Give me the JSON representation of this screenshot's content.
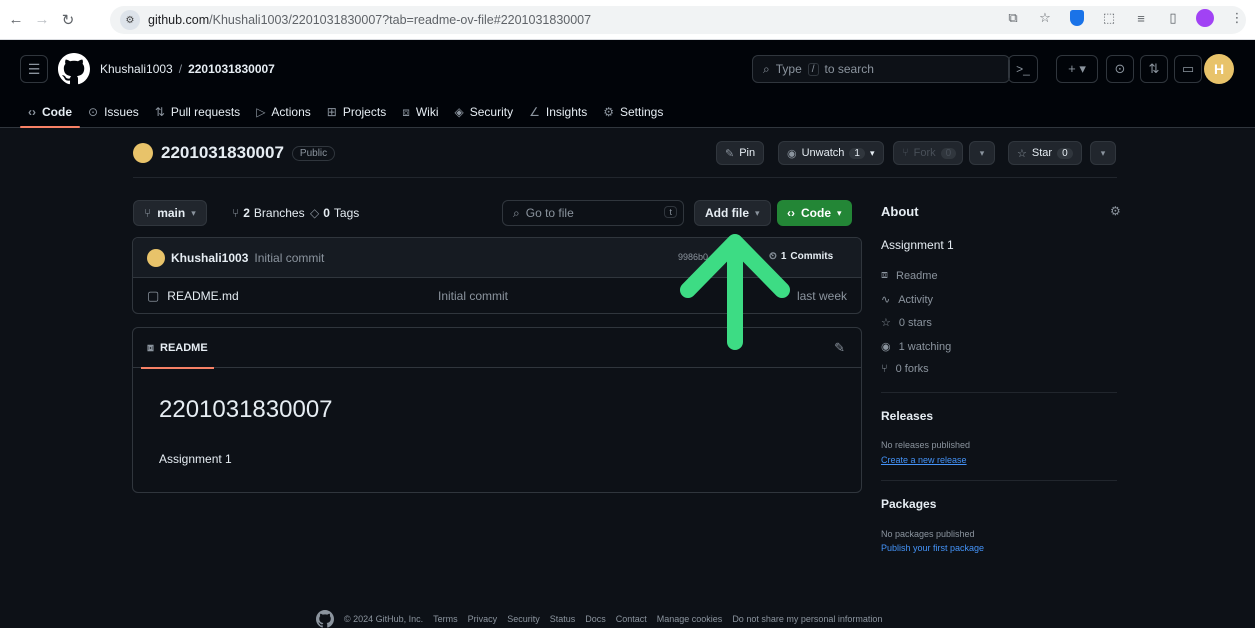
{
  "browser": {
    "url_host": "github.com",
    "url_path": "/Khushali1003/2201031830007?tab=readme-ov-file#2201031830007"
  },
  "header": {
    "owner": "Khushali1003",
    "separator": "/",
    "repo": "2201031830007",
    "search_placeholder": "Type",
    "search_key": "/",
    "search_suffix": "to search",
    "cmd": ">_",
    "avatar_letter": "H"
  },
  "tabs": [
    {
      "label": "Code",
      "icon": "code-icon"
    },
    {
      "label": "Issues",
      "icon": "issue-icon"
    },
    {
      "label": "Pull requests",
      "icon": "pull-request-icon"
    },
    {
      "label": "Actions",
      "icon": "play-icon"
    },
    {
      "label": "Projects",
      "icon": "table-icon"
    },
    {
      "label": "Wiki",
      "icon": "book-icon"
    },
    {
      "label": "Security",
      "icon": "shield-icon"
    },
    {
      "label": "Insights",
      "icon": "graph-icon"
    },
    {
      "label": "Settings",
      "icon": "gear-icon"
    }
  ],
  "repo_title": {
    "name": "2201031830007",
    "visibility": "Public"
  },
  "actions": {
    "pin": "Pin",
    "unwatch": "Unwatch",
    "unwatch_count": "1",
    "fork": "Fork",
    "fork_count": "0",
    "star": "Star",
    "star_count": "0"
  },
  "toolbar": {
    "branch": "main",
    "branches_count": "2",
    "branches_label": "Branches",
    "tags_count": "0",
    "tags_label": "Tags",
    "goto_placeholder": "Go to file",
    "goto_key": "t",
    "add_file": "Add file",
    "code": "Code"
  },
  "commit": {
    "author": "Khushali1003",
    "message": "Initial commit",
    "hash": "9986b0",
    "commits_count": "1",
    "commits_label": "Commits"
  },
  "files": [
    {
      "name": "README.md",
      "commit": "Initial commit",
      "date": "last week"
    }
  ],
  "readme": {
    "tab": "README",
    "heading": "2201031830007",
    "body": "Assignment 1"
  },
  "about": {
    "title": "About",
    "description": "Assignment 1",
    "items": [
      {
        "label": "Readme",
        "icon": "book-icon"
      },
      {
        "label": "Activity",
        "icon": "pulse-icon"
      },
      {
        "label": "0 stars",
        "icon": "star-icon"
      },
      {
        "label": "1 watching",
        "icon": "eye-icon"
      },
      {
        "label": "0 forks",
        "icon": "fork-icon"
      }
    ]
  },
  "releases": {
    "title": "Releases",
    "note": "No releases published",
    "link": "Create a new release"
  },
  "packages": {
    "title": "Packages",
    "note": "No packages published",
    "link": "Publish your first package"
  },
  "footer": {
    "copyright": "© 2024 GitHub, Inc.",
    "links": [
      "Terms",
      "Privacy",
      "Security",
      "Status",
      "Docs",
      "Contact",
      "Manage cookies",
      "Do not share my personal information"
    ]
  },
  "colors": {
    "bg": "#0d1117",
    "accent_green": "#238636",
    "tab_underline": "#f78166",
    "link": "#4493f8",
    "annotation_arrow": "#3ddc84"
  }
}
